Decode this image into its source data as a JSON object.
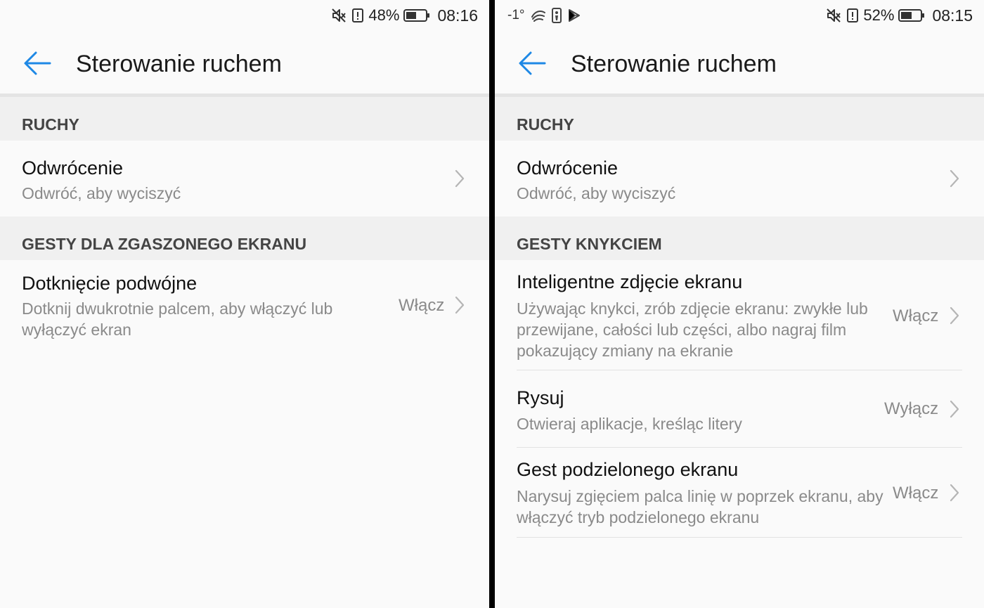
{
  "left": {
    "status": {
      "battery": "48%",
      "time": "08:16"
    },
    "header": {
      "title": "Sterowanie ruchem"
    },
    "sections": [
      {
        "title": "RUCHY"
      },
      {
        "title": "GESTY DLA ZGASZONEGO EKRANU"
      }
    ],
    "rows": [
      {
        "title": "Odwrócenie",
        "subtitle": "Odwróć, aby wyciszyć"
      },
      {
        "title": "Dotknięcie podwójne",
        "subtitle": "Dotknij dwukrotnie palcem, aby włączyć lub wyłączyć ekran",
        "value": "Włącz"
      }
    ]
  },
  "right": {
    "status": {
      "temperature": "-1°",
      "battery": "52%",
      "time": "08:15"
    },
    "header": {
      "title": "Sterowanie ruchem"
    },
    "sections": [
      {
        "title": "RUCHY"
      },
      {
        "title": "GESTY KNYKCIEM"
      }
    ],
    "rows": [
      {
        "title": "Odwrócenie",
        "subtitle": "Odwróć, aby wyciszyć"
      },
      {
        "title": "Inteligentne zdjęcie ekranu",
        "subtitle": "Używając knykci, zrób zdjęcie ekranu: zwykłe lub przewijane, całości lub części, albo nagraj film pokazujący zmiany na ekranie",
        "value": "Włącz"
      },
      {
        "title": "Rysuj",
        "subtitle": "Otwieraj aplikacje, kreśląc litery",
        "value": "Wyłącz"
      },
      {
        "title": "Gest podzielonego ekranu",
        "subtitle": "Narysuj zgięciem palca linię w poprzek ekranu, aby włączyć tryb podzielonego ekranu",
        "value": "Włącz"
      }
    ]
  },
  "colors": {
    "accent": "#1e88e5",
    "chevron": "#b5b5b5",
    "section_bg": "#f0f0f0",
    "page_bg": "#fafafa"
  },
  "icons": [
    "mute-icon",
    "alert-icon",
    "battery-icon",
    "weather-icon",
    "nba-icon",
    "play-store-icon",
    "back-arrow-icon",
    "chevron-right-icon"
  ]
}
